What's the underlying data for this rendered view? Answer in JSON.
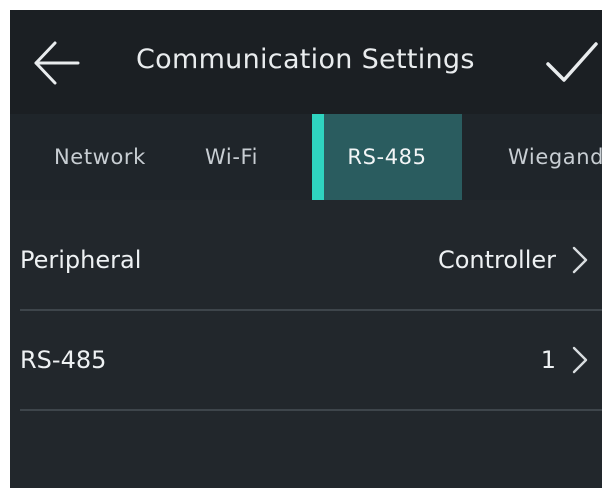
{
  "header": {
    "title": "Communication Settings",
    "back_icon": "arrow-left-icon",
    "confirm_icon": "checkmark-icon"
  },
  "tabs": [
    {
      "label": "Network",
      "active": false
    },
    {
      "label": "Wi-Fi",
      "active": false
    },
    {
      "label": "RS-485",
      "active": true
    },
    {
      "label": "Wiegand",
      "active": false
    }
  ],
  "settings": [
    {
      "label": "Peripheral",
      "value": "Controller",
      "icon": "chevron-right-icon"
    },
    {
      "label": "RS-485",
      "value": "1",
      "icon": "chevron-right-icon"
    }
  ],
  "colors": {
    "background": "#22272c",
    "header": "#1b1f23",
    "tab_active_bg": "#2a5c5f",
    "tab_indicator": "#2fd4c0",
    "divider": "#3e454b",
    "text": "#eef1f3"
  }
}
